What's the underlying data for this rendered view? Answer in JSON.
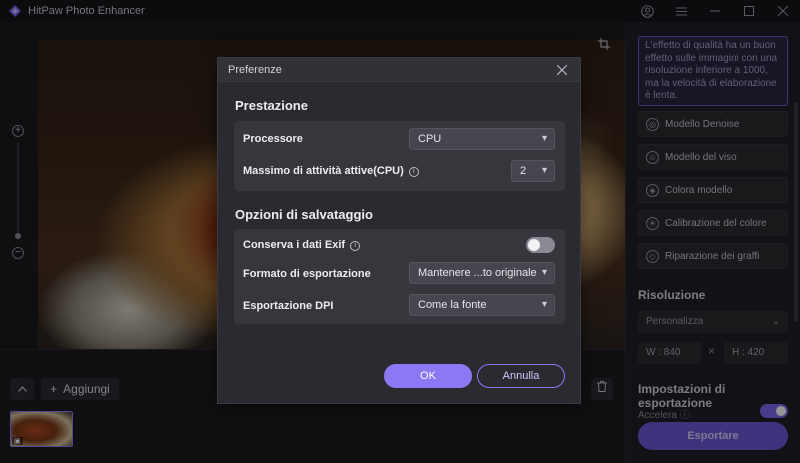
{
  "app": {
    "title": "HitPaw Photo Enhancer",
    "accent": "#8a78f5"
  },
  "canvas": {
    "add_label": "Aggiungi",
    "zoom_in": "+",
    "zoom_out": "−"
  },
  "right_panel": {
    "description": "L'effetto di qualità ha un buon effetto sulle immagini con una risoluzione inferiore a 1000, ma la velocità di elaborazione è lenta.",
    "models": [
      {
        "label": "Modello Denoise",
        "icon": "denoise-icon"
      },
      {
        "label": "Modello del viso",
        "icon": "face-icon"
      },
      {
        "label": "Colora modello",
        "icon": "colorize-icon"
      },
      {
        "label": "Calibrazione del colore",
        "icon": "sun-icon"
      },
      {
        "label": "Riparazione dei graffi",
        "icon": "scratch-icon"
      }
    ],
    "resolution_heading": "Risoluzione",
    "resolution_value": "Personalizza",
    "width_label": "W : 840",
    "height_label": "H : 420",
    "export_heading": "Impostazioni di esportazione",
    "accelerate_label": "Accelera",
    "export_button": "Esportare"
  },
  "dialog": {
    "title": "Preferenze",
    "section_performance": "Prestazione",
    "processor_label": "Processore",
    "processor_value": "CPU",
    "max_tasks_label": "Massimo di attività attive(CPU)",
    "max_tasks_value": "2",
    "section_save": "Opzioni di salvataggio",
    "exif_label": "Conserva i dati Exif",
    "exif_enabled": false,
    "format_label": "Formato di esportazione",
    "format_value": "Mantenere ...to originale",
    "dpi_label": "Esportazione DPI",
    "dpi_value": "Come la fonte",
    "ok_label": "OK",
    "cancel_label": "Annulla"
  }
}
